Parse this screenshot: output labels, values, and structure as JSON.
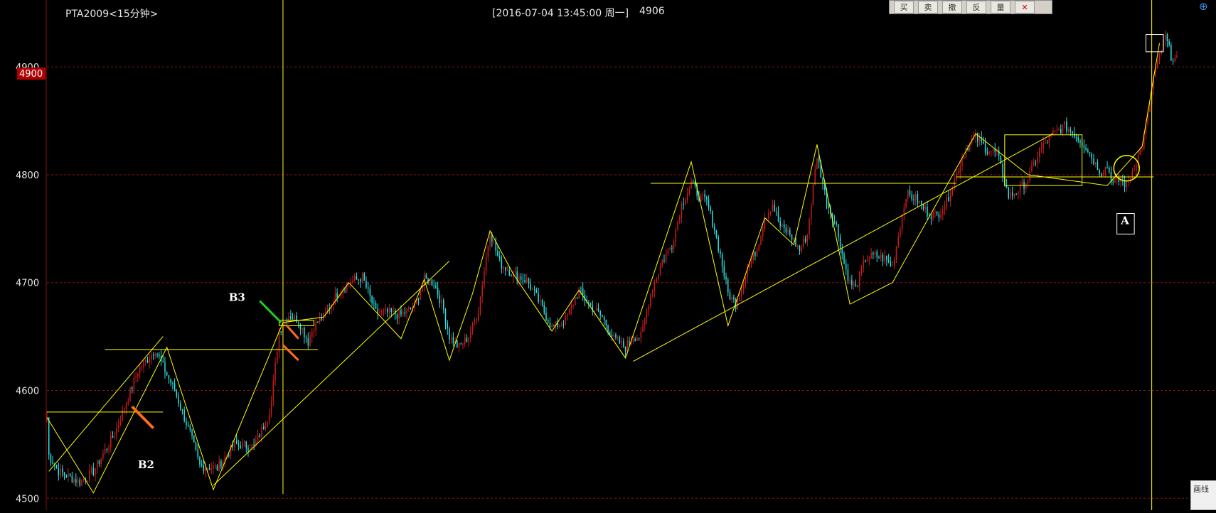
{
  "header": {
    "symbol": "PTA2009<15分钟>",
    "cursor_info": "[2016-07-04  13:45:00 周一]",
    "cursor_price": "4906"
  },
  "toolbar": {
    "buttons": [
      "买",
      "卖",
      "撤",
      "反",
      "量"
    ],
    "close_icon": "close-icon"
  },
  "draw_panel": {
    "label": "画线"
  },
  "colors": {
    "background": "#000000",
    "up_candle": "#cc1c1c",
    "down_candle": "#28e6e6",
    "annotation": "#ffff00",
    "arrow_orange": "#ff6a1a",
    "arrow_green": "#22cc22",
    "grid": "#8a1010",
    "price_tag": "#b00000"
  },
  "chart_data": {
    "type": "candlestick",
    "ylim": [
      4489,
      4962
    ],
    "y_ticks": [
      4500,
      4600,
      4700,
      4800,
      4900
    ],
    "highlight_price": 4900,
    "anchors": [
      [
        0,
        4575
      ],
      [
        1,
        4540
      ],
      [
        6,
        4525
      ],
      [
        17,
        4515
      ],
      [
        24,
        4525
      ],
      [
        35,
        4560
      ],
      [
        47,
        4618
      ],
      [
        56,
        4638
      ],
      [
        60,
        4622
      ],
      [
        66,
        4600
      ],
      [
        74,
        4560
      ],
      [
        79,
        4530
      ],
      [
        88,
        4528
      ],
      [
        97,
        4550
      ],
      [
        107,
        4548
      ],
      [
        114,
        4575
      ],
      [
        116,
        4590
      ],
      [
        120,
        4655
      ],
      [
        125,
        4670
      ],
      [
        130,
        4665
      ],
      [
        135,
        4645
      ],
      [
        138,
        4660
      ],
      [
        143,
        4668
      ],
      [
        150,
        4690
      ],
      [
        156,
        4700
      ],
      [
        163,
        4705
      ],
      [
        170,
        4672
      ],
      [
        176,
        4672
      ],
      [
        183,
        4670
      ],
      [
        190,
        4678
      ],
      [
        195,
        4703
      ],
      [
        200,
        4700
      ],
      [
        205,
        4675
      ],
      [
        208,
        4650
      ],
      [
        213,
        4640
      ],
      [
        218,
        4650
      ],
      [
        223,
        4675
      ],
      [
        229,
        4748
      ],
      [
        234,
        4718
      ],
      [
        241,
        4708
      ],
      [
        248,
        4702
      ],
      [
        255,
        4680
      ],
      [
        261,
        4658
      ],
      [
        268,
        4665
      ],
      [
        275,
        4693
      ],
      [
        280,
        4680
      ],
      [
        287,
        4668
      ],
      [
        293,
        4648
      ],
      [
        299,
        4640
      ],
      [
        303,
        4650
      ],
      [
        307,
        4650
      ],
      [
        312,
        4690
      ],
      [
        318,
        4720
      ],
      [
        323,
        4735
      ],
      [
        328,
        4772
      ],
      [
        333,
        4792
      ],
      [
        337,
        4780
      ],
      [
        341,
        4775
      ],
      [
        345,
        4750
      ],
      [
        348,
        4725
      ],
      [
        352,
        4690
      ],
      [
        356,
        4680
      ],
      [
        362,
        4713
      ],
      [
        367,
        4732
      ],
      [
        371,
        4760
      ],
      [
        375,
        4773
      ],
      [
        379,
        4752
      ],
      [
        384,
        4745
      ],
      [
        389,
        4730
      ],
      [
        393,
        4745
      ],
      [
        398,
        4818
      ],
      [
        403,
        4775
      ],
      [
        408,
        4752
      ],
      [
        412,
        4718
      ],
      [
        415,
        4700
      ],
      [
        418,
        4695
      ],
      [
        423,
        4722
      ],
      [
        428,
        4725
      ],
      [
        433,
        4722
      ],
      [
        437,
        4715
      ],
      [
        444,
        4782
      ],
      [
        449,
        4778
      ],
      [
        455,
        4765
      ],
      [
        460,
        4762
      ],
      [
        465,
        4775
      ],
      [
        470,
        4800
      ],
      [
        475,
        4825
      ],
      [
        480,
        4835
      ],
      [
        486,
        4823
      ],
      [
        491,
        4820
      ],
      [
        497,
        4780
      ],
      [
        502,
        4785
      ],
      [
        507,
        4796
      ],
      [
        513,
        4822
      ],
      [
        520,
        4838
      ],
      [
        526,
        4845
      ],
      [
        531,
        4838
      ],
      [
        537,
        4826
      ],
      [
        542,
        4810
      ],
      [
        545,
        4802
      ],
      [
        548,
        4808
      ],
      [
        551,
        4792
      ],
      [
        555,
        4795
      ],
      [
        558,
        4790
      ],
      [
        562,
        4808
      ],
      [
        566,
        4826
      ],
      [
        569,
        4855
      ],
      [
        572,
        4890
      ],
      [
        575,
        4910
      ],
      [
        578,
        4928
      ],
      [
        581,
        4910
      ],
      [
        584,
        4906
      ]
    ],
    "bars": 585,
    "annotations": {
      "labels": [
        {
          "text": "B2",
          "bar": 47,
          "price": 4528
        },
        {
          "text": "B3",
          "bar": 94,
          "price": 4683
        },
        {
          "text": "A",
          "bar": 555,
          "price": 4754
        }
      ]
    }
  }
}
